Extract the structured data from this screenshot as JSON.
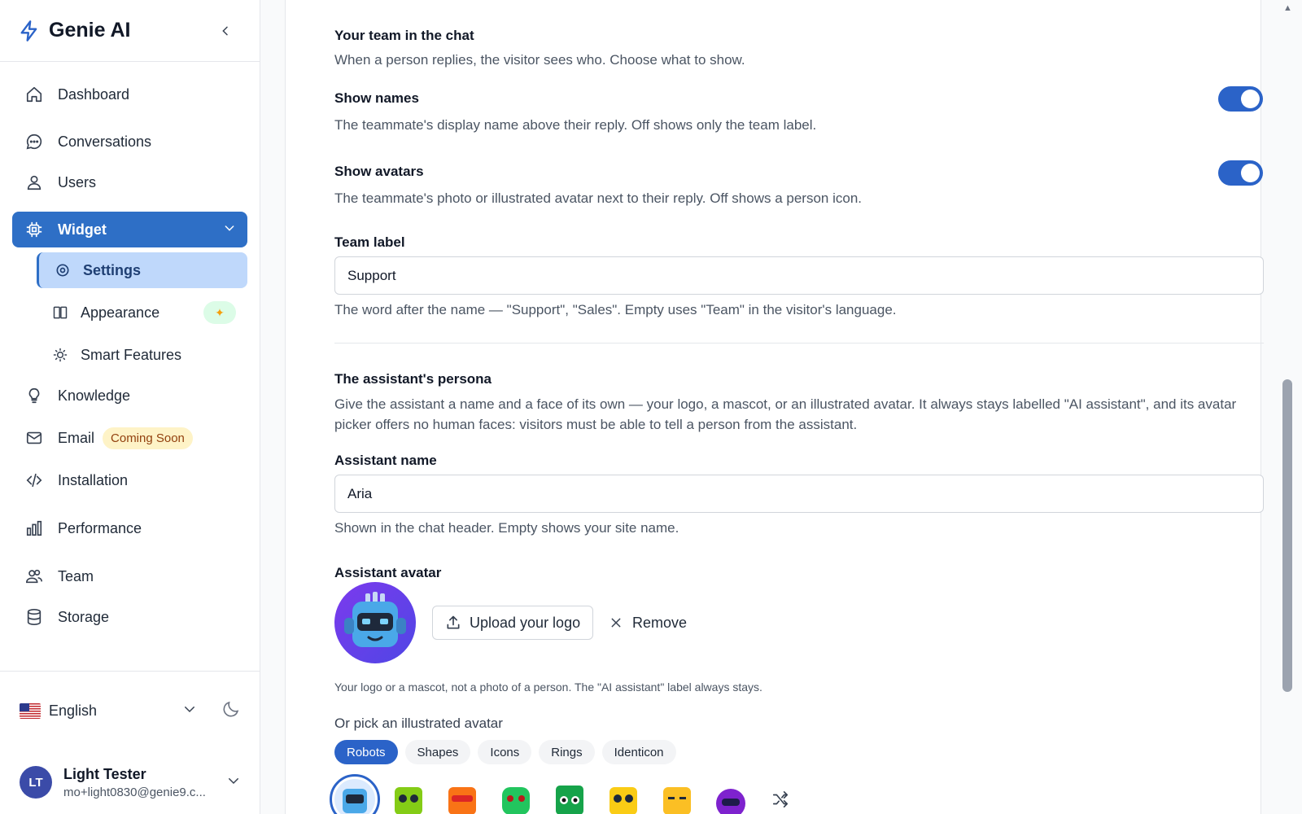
{
  "brand": {
    "name": "Genie AI"
  },
  "nav": {
    "dashboard": "Dashboard",
    "conversations": "Conversations",
    "users": "Users",
    "widget": "Widget",
    "settings": "Settings",
    "appearance": "Appearance",
    "smart_features": "Smart Features",
    "knowledge": "Knowledge",
    "email": "Email",
    "email_badge": "Coming Soon",
    "installation": "Installation",
    "performance": "Performance",
    "team": "Team",
    "storage": "Storage"
  },
  "language": {
    "selected": "English"
  },
  "user": {
    "initials": "LT",
    "name": "Light Tester",
    "email": "mo+light0830@genie9.c..."
  },
  "team_section": {
    "title": "Your team in the chat",
    "description": "When a person replies, the visitor sees who. Choose what to show.",
    "show_names": {
      "label": "Show names",
      "description": "The teammate's display name above their reply. Off shows only the team label.",
      "enabled": true
    },
    "show_avatars": {
      "label": "Show avatars",
      "description": "The teammate's photo or illustrated avatar next to their reply. Off shows a person icon.",
      "enabled": true
    },
    "team_label": {
      "label": "Team label",
      "value": "Support",
      "help": "The word after the name — \"Support\", \"Sales\". Empty uses \"Team\" in the visitor's language."
    }
  },
  "persona_section": {
    "title": "The assistant's persona",
    "description_line1": "Give the assistant a name and a face of its own — your logo, a mascot, or an illustrated avatar. It always stays labelled \"AI assistant\", and its avatar",
    "description_line2": "picker offers no human faces: visitors must be able to tell a person from the assistant.",
    "assistant_name": {
      "label": "Assistant name",
      "value": "Aria",
      "help": "Shown in the chat header. Empty shows your site name."
    },
    "assistant_avatar": {
      "label": "Assistant avatar",
      "upload_label": "Upload your logo",
      "remove_label": "Remove",
      "note": "Your logo or a mascot, not a photo of a person. The \"AI assistant\" label always stays.",
      "pick_label": "Or pick an illustrated avatar",
      "categories": [
        "Robots",
        "Shapes",
        "Icons",
        "Rings",
        "Identicon"
      ],
      "selected_category": "Robots"
    }
  },
  "colors": {
    "accent": "#2b63c8",
    "sidebar_active": "#2e6fc6",
    "sub_active": "#bfd8fb"
  }
}
